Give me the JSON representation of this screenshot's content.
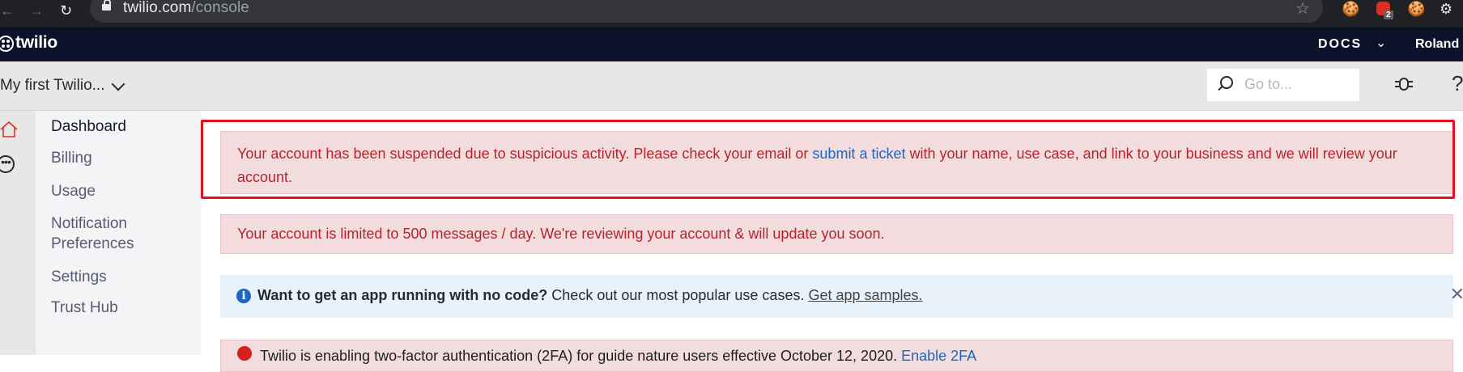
{
  "browser": {
    "url_domain": "twilio.com",
    "url_path": "/console",
    "extension_badge": "2"
  },
  "topbar": {
    "logo_text": "twilio",
    "docs_label": "DOCS",
    "user_name": "Roland"
  },
  "subheader": {
    "project_name": "My first Twilio...",
    "search_placeholder": "Go to..."
  },
  "sidebar": {
    "items": [
      {
        "label": "Dashboard"
      },
      {
        "label": "Billing"
      },
      {
        "label": "Usage"
      },
      {
        "label": "Notification"
      },
      {
        "label": "Preferences"
      },
      {
        "label": "Settings"
      },
      {
        "label": "Trust Hub"
      }
    ]
  },
  "alerts": {
    "suspended": {
      "text_before": "Your account has been suspended due to suspicious activity. Please check your email or ",
      "link": "submit a ticket",
      "text_after": " with your name, use case, and link to your business and we will review your",
      "text_line2": "account."
    },
    "limited": {
      "text": "Your account is limited to 500 messages / day. We're reviewing your account & will update you soon."
    },
    "no_code": {
      "bold": "Want to get an app running with no code?",
      "text": " Check out our most popular use cases. ",
      "link": "Get app samples."
    },
    "twofa": {
      "text": "Twilio is enabling two-factor authentication (2FA) for guide nature users effective October 12, 2020.",
      "link": "Enable 2FA"
    }
  },
  "icons": {
    "back": "arrow-left-icon",
    "forward": "arrow-right-icon",
    "reload": "reload-icon",
    "lock": "lock-icon",
    "star": "star-icon",
    "search": "search-icon",
    "bug": "bug-icon",
    "help": "help-icon",
    "home": "home-icon",
    "more": "more-icon",
    "info": "info-icon",
    "close": "close-icon"
  },
  "colors": {
    "topbar_bg": "#0d122b",
    "error_bg": "#f3dcdd",
    "error_text": "#b5242a",
    "info_bg": "#e8f2fb",
    "link": "#1f66c1",
    "highlight": "#ec0d1b"
  }
}
